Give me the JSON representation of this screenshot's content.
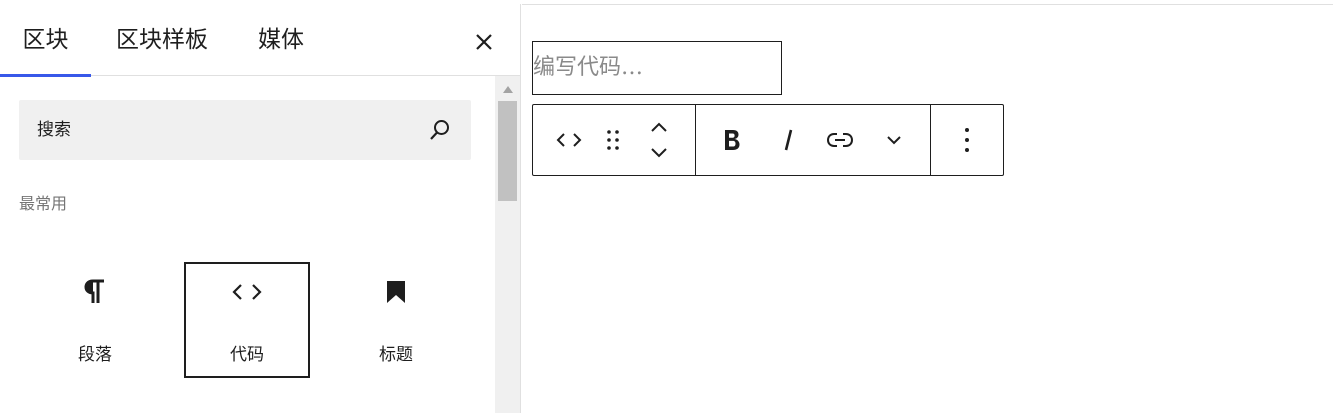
{
  "inserter": {
    "tabs": [
      {
        "label": "区块",
        "active": true
      },
      {
        "label": "区块样板",
        "active": false
      },
      {
        "label": "媒体",
        "active": false
      }
    ],
    "close_icon": "close-icon",
    "search": {
      "placeholder": "搜索",
      "icon": "search-icon"
    },
    "category_label": "最常用",
    "blocks": [
      {
        "label": "段落",
        "icon": "pilcrow-icon",
        "selected": false
      },
      {
        "label": "代码",
        "icon": "code-icon",
        "selected": true
      },
      {
        "label": "标题",
        "icon": "bookmark-icon",
        "selected": false
      }
    ]
  },
  "editor": {
    "code_placeholder": "编写代码…",
    "toolbar": {
      "group1": [
        "code-icon",
        "drag-handle-icon",
        "move-up-icon",
        "move-down-icon"
      ],
      "group2": [
        "bold-icon",
        "italic-icon",
        "link-icon",
        "chevron-down-icon"
      ],
      "group3": [
        "more-options-icon"
      ]
    }
  },
  "colors": {
    "accent": "#3858e9",
    "text": "#1e1e1e",
    "muted": "#757575",
    "search_bg": "#f0f0f0",
    "border": "#e0e0e0"
  }
}
